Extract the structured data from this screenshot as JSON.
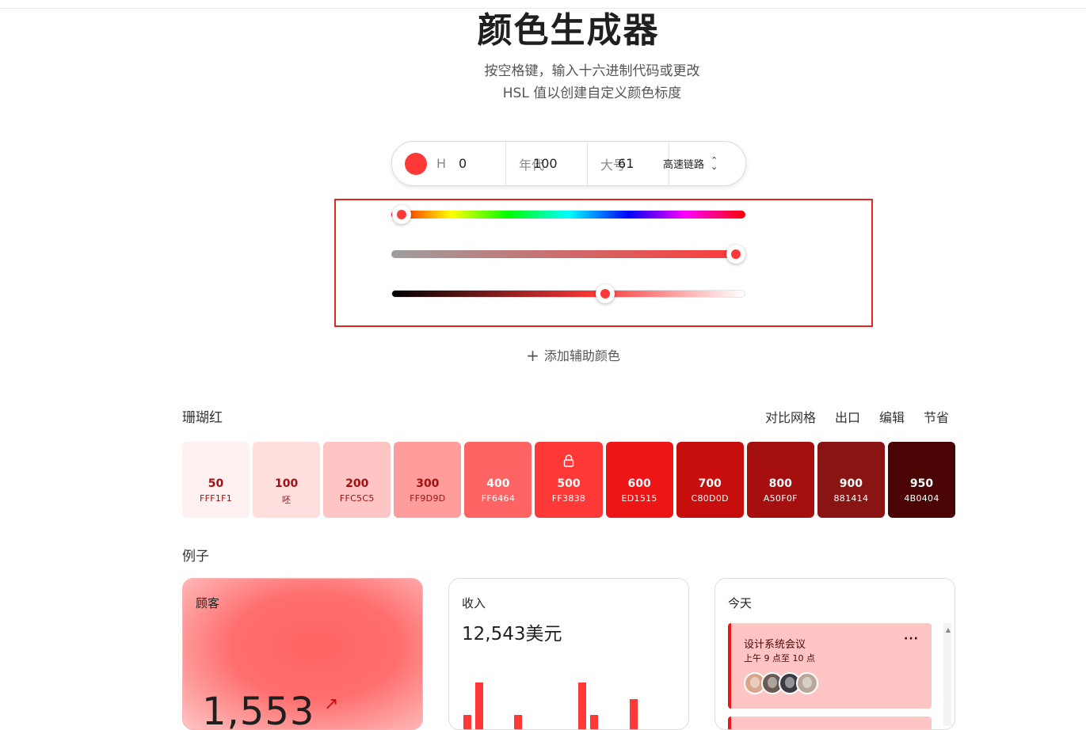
{
  "header": {
    "title": "颜色生成器",
    "subtitle_line1": "按空格键，输入十六进制代码或更改",
    "subtitle_line2": "HSL 值以创建自定义颜色标度"
  },
  "hsl": {
    "swatch_color": "#FF3838",
    "h_label": "H",
    "h_value": "0",
    "s_label": "年代",
    "s_value": "100",
    "l_label": "大号",
    "l_value": "61",
    "mode_label": "高速链路"
  },
  "sliders": {
    "hue_value": 0,
    "saturation_value": 100,
    "lightness_value": 61
  },
  "add_secondary": "添加辅助颜色",
  "palette": {
    "name": "珊瑚红",
    "actions": [
      "对比网格",
      "出口",
      "编辑",
      "节省"
    ],
    "swatches": [
      {
        "shade": "50",
        "hex": "FFF1F1",
        "bg": "#FFF1F1",
        "fg": "#A50F0F"
      },
      {
        "shade": "100",
        "hex": "呸",
        "bg": "#FFDEDE",
        "fg": "#A50F0F"
      },
      {
        "shade": "200",
        "hex": "FFC5C5",
        "bg": "#FFC5C5",
        "fg": "#A50F0F"
      },
      {
        "shade": "300",
        "hex": "FF9D9D",
        "bg": "#FF9D9D",
        "fg": "#A50F0F"
      },
      {
        "shade": "400",
        "hex": "FF6464",
        "bg": "#FF6464",
        "fg": "#FFFFFF"
      },
      {
        "shade": "500",
        "hex": "FF3838",
        "bg": "#FF3838",
        "fg": "#FFFFFF",
        "locked": true
      },
      {
        "shade": "600",
        "hex": "ED1515",
        "bg": "#ED1515",
        "fg": "#FFFFFF"
      },
      {
        "shade": "700",
        "hex": "C80D0D",
        "bg": "#C80D0D",
        "fg": "#FFFFFF"
      },
      {
        "shade": "800",
        "hex": "A50F0F",
        "bg": "#A50F0F",
        "fg": "#FFFFFF"
      },
      {
        "shade": "900",
        "hex": "881414",
        "bg": "#881414",
        "fg": "#FFFFFF"
      },
      {
        "shade": "950",
        "hex": "4B0404",
        "bg": "#4B0404",
        "fg": "#FFFFFF"
      }
    ]
  },
  "examples": {
    "label": "例子",
    "customers": {
      "title": "顾客",
      "value": "1,553",
      "trend_icon": "arrow-up-right-icon"
    },
    "revenue": {
      "title": "收入",
      "value": "12,543美元"
    },
    "today": {
      "title": "今天",
      "event_title": "设计系统会议",
      "event_time": "上午 9 点至 10 点",
      "more_label": "···"
    }
  }
}
